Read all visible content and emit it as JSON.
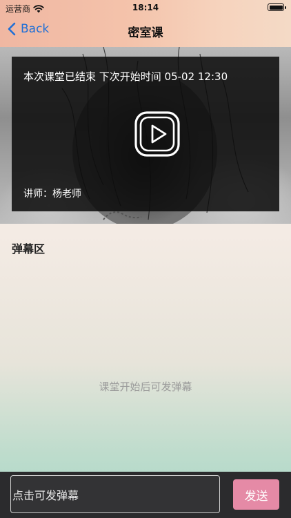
{
  "status_bar": {
    "carrier": "运营商",
    "time": "18:14"
  },
  "nav": {
    "back_label": "Back",
    "title": "密室课"
  },
  "player": {
    "status_text": "本次课堂已结束 下次开始时间 05-02 12:30",
    "teacher_text": "讲师：杨老师"
  },
  "danmaku": {
    "section_label": "弹幕区",
    "empty_hint": "课堂开始后可发弹幕"
  },
  "input_bar": {
    "placeholder": "点击可发弹幕",
    "send_label": "发送"
  },
  "colors": {
    "accent": "#1f6fd6",
    "send_button": "#e58aa6",
    "input_bar_bg": "#2b2b2d"
  }
}
